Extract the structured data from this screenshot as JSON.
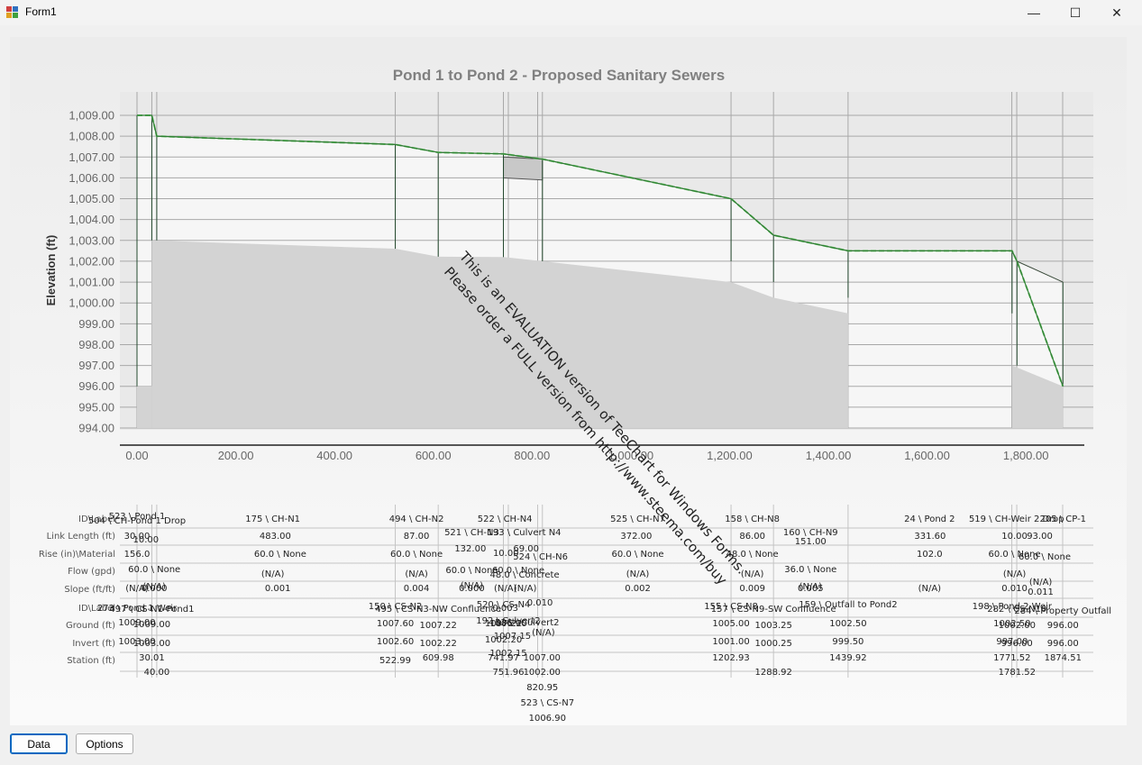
{
  "window": {
    "title": "Form1",
    "minimize_glyph": "—",
    "maximize_glyph": "☐",
    "close_glyph": "✕"
  },
  "buttons": {
    "data": "Data",
    "options": "Options"
  },
  "watermark": {
    "line1": "This is an EVALUATION version of TeeChart for Windows Forms.",
    "line2": "Please order a FULL version from http://www.steema.com/buy"
  },
  "chart_data": {
    "type": "line",
    "title": "Pond 1 to Pond 2 - Proposed Sanitary Sewers",
    "ylabel": "Elevation (ft)",
    "xlabel": "",
    "ylim": [
      994,
      1009
    ],
    "xlim": [
      0,
      1880
    ],
    "grid": true,
    "y_ticks": [
      "1,009.00",
      "1,008.00",
      "1,007.00",
      "1,006.00",
      "1,005.00",
      "1,004.00",
      "1,003.00",
      "1,002.00",
      "1,001.00",
      "1,000.00",
      "999.00",
      "998.00",
      "997.00",
      "996.00",
      "995.00",
      "994.00"
    ],
    "x_ticks": [
      "0.00",
      "200.00",
      "400.00",
      "600.00",
      "800.00",
      "1,000.00",
      "1,200.00",
      "1,400.00",
      "1,600.00",
      "1,800.00"
    ],
    "node_stations": [
      0,
      30.01,
      40,
      522.99,
      609.98,
      741.97,
      751.96,
      811.32,
      820.95,
      1202.93,
      1288.92,
      1439.92,
      1771.52,
      1781.52,
      1874.51
    ],
    "hgl_series": {
      "x": [
        0,
        30,
        40,
        523,
        610,
        742,
        821,
        1203,
        1289,
        1440,
        1772,
        1782,
        1875
      ],
      "y": [
        1009.0,
        1009.0,
        1008.0,
        1007.6,
        1007.22,
        1007.15,
        1006.9,
        1005.0,
        1003.25,
        1002.5,
        1002.5,
        1002.0,
        996.0
      ]
    },
    "crown_series": {
      "x": [
        0,
        30,
        40,
        523,
        610,
        742,
        821,
        1203,
        1289,
        1440,
        1772,
        1782,
        1875
      ],
      "y": [
        1009.0,
        1009.0,
        1008.0,
        1007.6,
        1007.22,
        1007.15,
        1006.9,
        1005.0,
        1003.25,
        1002.5,
        1002.5,
        1002.0,
        1001.0
      ]
    },
    "ground_series": {
      "x": [
        30,
        523,
        610,
        742,
        821,
        1203,
        1289,
        1440
      ],
      "y": [
        1003.0,
        1002.6,
        1002.22,
        1002.2,
        1002.0,
        1001.0,
        1000.25,
        999.5
      ]
    },
    "ground_series_b": {
      "x": [
        1772,
        1875
      ],
      "y": [
        997.0,
        996.0
      ]
    },
    "pond1_ground": {
      "x": [
        0,
        30
      ],
      "y": 996.0
    },
    "culvert_box": {
      "x": [
        742,
        821
      ],
      "y_top": 1007.0,
      "y_bottom": 1006.0
    },
    "structure_bottoms": [
      996.0,
      1003.0,
      1003.0,
      1002.6,
      1002.22,
      1002.2,
      1002.0,
      1002.0,
      1001.0,
      1000.25,
      999.5,
      997.0,
      996.0,
      996.0
    ],
    "table_row_labels": [
      "ID\\Label",
      "Link Length (ft)",
      "Rise (in)\\Material",
      "Flow (gpd)",
      "Slope (ft/ft)",
      "ID\\Label",
      "Ground (ft)",
      "Invert (ft)",
      "Station (ft)"
    ],
    "table_cells": [
      {
        "text": "523 \\ Pond 1",
        "s": 0,
        "r": 0,
        "dy": -3
      },
      {
        "text": "504 \\ CH-Pond 1 Drop",
        "s": 0,
        "r": 0,
        "dy": 2
      },
      {
        "text": "175 \\ CH-N1",
        "s": 275,
        "r": 0,
        "dy": 0
      },
      {
        "text": "494 \\ CH-N2",
        "s": 566,
        "r": 0,
        "dy": 0
      },
      {
        "text": "522 \\ CH-N4",
        "s": 745,
        "r": 0,
        "dy": 0
      },
      {
        "text": "525 \\ CH-N7",
        "s": 1014,
        "r": 0,
        "dy": 0
      },
      {
        "text": "158 \\ CH-N8",
        "s": 1246,
        "r": 0,
        "dy": 0
      },
      {
        "text": "24 \\ Pond 2",
        "s": 1605,
        "r": 0,
        "dy": 0
      },
      {
        "text": "519 \\ CH-Weir 2 Drop",
        "s": 1781,
        "r": 0,
        "dy": 0
      },
      {
        "text": "205 \\ CP-1",
        "s": 1875,
        "r": 0,
        "dy": 0
      },
      {
        "text": "521 \\ CH-N3",
        "s": 678,
        "r": 1,
        "dy": -4
      },
      {
        "text": "193 \\ Culvert N4",
        "s": 784,
        "r": 1,
        "dy": -4
      },
      {
        "text": "160 \\ CH-N9",
        "s": 1364,
        "r": 1,
        "dy": -4
      },
      {
        "text": "524 \\ CH-N6",
        "s": 817,
        "r": 1,
        "dy": 23
      },
      {
        "text": "30.00",
        "s": 0,
        "r": 1,
        "dy": 0
      },
      {
        "text": "10.00",
        "s": 18,
        "r": 1,
        "dy": 4
      },
      {
        "text": "483.00",
        "s": 280,
        "r": 1,
        "dy": 0
      },
      {
        "text": "87.00",
        "s": 566,
        "r": 1,
        "dy": 0
      },
      {
        "text": "132.00",
        "s": 675,
        "r": 1,
        "dy": 14
      },
      {
        "text": "10.00",
        "s": 747,
        "r": 1,
        "dy": 19
      },
      {
        "text": "69.00",
        "s": 788,
        "r": 1,
        "dy": 14
      },
      {
        "text": "372.00",
        "s": 1011,
        "r": 1,
        "dy": 0
      },
      {
        "text": "86.00",
        "s": 1246,
        "r": 1,
        "dy": 0
      },
      {
        "text": "151.00",
        "s": 1364,
        "r": 1,
        "dy": 6
      },
      {
        "text": "331.60",
        "s": 1606,
        "r": 1,
        "dy": 0
      },
      {
        "text": "10.00",
        "s": 1777,
        "r": 1,
        "dy": 0
      },
      {
        "text": "93.00",
        "s": 1828,
        "r": 1,
        "dy": 0
      },
      {
        "text": "156.0",
        "s": 0,
        "r": 2,
        "dy": 0
      },
      {
        "text": "60.0 \\ None",
        "s": 290,
        "r": 2,
        "dy": 0
      },
      {
        "text": "60.0 \\ None",
        "s": 566,
        "r": 2,
        "dy": 0
      },
      {
        "text": "60.0 \\ None",
        "s": 1014,
        "r": 2,
        "dy": 0
      },
      {
        "text": "48.0 \\ None",
        "s": 1246,
        "r": 2,
        "dy": 0
      },
      {
        "text": "102.0",
        "s": 1605,
        "r": 2,
        "dy": 0
      },
      {
        "text": "60.0 \\ None",
        "s": 1777,
        "r": 2,
        "dy": 0
      },
      {
        "text": "60.0 \\ None",
        "s": 1838,
        "r": 2,
        "dy": 3
      },
      {
        "text": "60.0 \\ None",
        "s": 35,
        "r": 2,
        "dy": 17
      },
      {
        "text": "60.0 \\ None",
        "s": 678,
        "r": 2,
        "dy": 18
      },
      {
        "text": "60.0 \\ None",
        "s": 772,
        "r": 2,
        "dy": 18
      },
      {
        "text": "48.0 \\ Concrete",
        "s": 785,
        "r": 2,
        "dy": 23
      },
      {
        "text": "36.0 \\ None",
        "s": 1364,
        "r": 2,
        "dy": 17
      },
      {
        "text": "(N/A)",
        "s": 275,
        "r": 3,
        "dy": 3
      },
      {
        "text": "(N/A)",
        "s": 566,
        "r": 3,
        "dy": 3
      },
      {
        "text": "(N/A)",
        "s": 1014,
        "r": 3,
        "dy": 3
      },
      {
        "text": "(N/A)",
        "s": 1246,
        "r": 3,
        "dy": 3
      },
      {
        "text": "(N/A)",
        "s": 1777,
        "r": 3,
        "dy": 3
      },
      {
        "text": "(N/A)",
        "s": 1830,
        "r": 3,
        "dy": 12
      },
      {
        "text": "(N/A)",
        "s": 35,
        "r": 3,
        "dy": 17
      },
      {
        "text": "(N/A)",
        "s": 678,
        "r": 3,
        "dy": 16
      },
      {
        "text": "(N/A)",
        "s": 1364,
        "r": 3,
        "dy": 17
      },
      {
        "text": "(N/A)",
        "s": 0,
        "r": 4,
        "dy": -1
      },
      {
        "text": "0.000",
        "s": 35,
        "r": 4,
        "dy": -1
      },
      {
        "text": "0.001",
        "s": 285,
        "r": 4,
        "dy": -1
      },
      {
        "text": "0.004",
        "s": 566,
        "r": 4,
        "dy": -1
      },
      {
        "text": "0.000",
        "s": 678,
        "r": 4,
        "dy": -1
      },
      {
        "text": "(N/A)",
        "s": 746,
        "r": 4,
        "dy": -1
      },
      {
        "text": "(N/A)",
        "s": 786,
        "r": 4,
        "dy": -1
      },
      {
        "text": "0.010",
        "s": 816,
        "r": 4,
        "dy": 15
      },
      {
        "text": "0.002",
        "s": 1014,
        "r": 4,
        "dy": -1
      },
      {
        "text": "0.009",
        "s": 1246,
        "r": 4,
        "dy": -1
      },
      {
        "text": "0.005",
        "s": 1364,
        "r": 4,
        "dy": -1
      },
      {
        "text": "(N/A)",
        "s": 1605,
        "r": 4,
        "dy": -1
      },
      {
        "text": "0.010",
        "s": 1777,
        "r": 4,
        "dy": -1
      },
      {
        "text": "0.011",
        "s": 1830,
        "r": 4,
        "dy": 3
      },
      {
        "text": "0.003",
        "s": 746,
        "r": 4,
        "dy": 21
      },
      {
        "text": "273 \\ Pond 1 Weir",
        "s": 0,
        "r": 5,
        "dy": 0
      },
      {
        "text": "497 \\ CS-N1-Pond1",
        "s": 30,
        "r": 5,
        "dy": 1
      },
      {
        "text": "150 \\ CS-N2",
        "s": 523,
        "r": 5,
        "dy": -2
      },
      {
        "text": "495 \\ CS-N3-NW Confluence",
        "s": 610,
        "r": 5,
        "dy": 1
      },
      {
        "text": "520 \\ CS-N4",
        "s": 742,
        "r": 5,
        "dy": -4
      },
      {
        "text": "192 \\ Culvert2",
        "s": 752,
        "r": 5,
        "dy": 14
      },
      {
        "text": "526 \\ Culvert2",
        "s": 790,
        "r": 5,
        "dy": 16
      },
      {
        "text": "155 \\ CS-N8",
        "s": 1203,
        "r": 5,
        "dy": -2
      },
      {
        "text": "157 \\ CS-N9-SW Confluence",
        "s": 1289,
        "r": 5,
        "dy": 1
      },
      {
        "text": "159 \\ Outfall to Pond2",
        "s": 1440,
        "r": 5,
        "dy": -4
      },
      {
        "text": "198 \\ Pond 2 Weir",
        "s": 1772,
        "r": 5,
        "dy": -2
      },
      {
        "text": "282 \\ CS-N10",
        "s": 1782,
        "r": 5,
        "dy": 1
      },
      {
        "text": "284 \\ Property Outfall",
        "s": 1875,
        "r": 5,
        "dy": 3
      },
      {
        "text": "1009.00",
        "s": 0,
        "r": 6,
        "dy": -3
      },
      {
        "text": "1009.00",
        "s": 30,
        "r": 6,
        "dy": -1
      },
      {
        "text": "1007.60",
        "s": 523,
        "r": 6,
        "dy": -2
      },
      {
        "text": "1007.22",
        "s": 610,
        "r": 6,
        "dy": 0
      },
      {
        "text": "1007.22",
        "s": 742,
        "r": 6,
        "dy": -2
      },
      {
        "text": "1006.90",
        "s": 752,
        "r": 6,
        "dy": -2
      },
      {
        "text": "1005.00",
        "s": 1203,
        "r": 6,
        "dy": -2
      },
      {
        "text": "1003.25",
        "s": 1289,
        "r": 6,
        "dy": 0
      },
      {
        "text": "1002.50",
        "s": 1440,
        "r": 6,
        "dy": -2
      },
      {
        "text": "1002.50",
        "s": 1772,
        "r": 6,
        "dy": -2
      },
      {
        "text": "1002.00",
        "s": 1782,
        "r": 6,
        "dy": 0
      },
      {
        "text": "996.00",
        "s": 1875,
        "r": 6,
        "dy": 0
      },
      {
        "text": "1003.00",
        "s": 0,
        "r": 7,
        "dy": -2
      },
      {
        "text": "1003.00",
        "s": 30,
        "r": 7,
        "dy": 0
      },
      {
        "text": "1002.60",
        "s": 523,
        "r": 7,
        "dy": -2
      },
      {
        "text": "1002.22",
        "s": 610,
        "r": 7,
        "dy": 0
      },
      {
        "text": "1002.20",
        "s": 742,
        "r": 7,
        "dy": -4
      },
      {
        "text": "1002.15",
        "s": 752,
        "r": 7,
        "dy": 11
      },
      {
        "text": "1007.15",
        "s": 760,
        "r": 7,
        "dy": -8
      },
      {
        "text": "(N/A)",
        "s": 823,
        "r": 7,
        "dy": -12
      },
      {
        "text": "1001.00",
        "s": 1203,
        "r": 7,
        "dy": -2
      },
      {
        "text": "1000.25",
        "s": 1289,
        "r": 7,
        "dy": 0
      },
      {
        "text": "999.50",
        "s": 1440,
        "r": 7,
        "dy": -2
      },
      {
        "text": "997.00",
        "s": 1772,
        "r": 7,
        "dy": -2
      },
      {
        "text": "996.00",
        "s": 1782,
        "r": 7,
        "dy": 0
      },
      {
        "text": "996.00",
        "s": 1875,
        "r": 7,
        "dy": 0
      },
      {
        "text": "30.01",
        "s": 30,
        "r": 8,
        "dy": -3
      },
      {
        "text": "40.00",
        "s": 40,
        "r": 8,
        "dy": 13
      },
      {
        "text": "522.99",
        "s": 523,
        "r": 8,
        "dy": 0
      },
      {
        "text": "609.98",
        "s": 610,
        "r": 8,
        "dy": -3
      },
      {
        "text": "741.97",
        "s": 742,
        "r": 8,
        "dy": -3
      },
      {
        "text": "1007.00",
        "s": 820,
        "r": 8,
        "dy": -3
      },
      {
        "text": "751.96",
        "s": 752,
        "r": 8,
        "dy": 13
      },
      {
        "text": "1002.00",
        "s": 820,
        "r": 8,
        "dy": 13
      },
      {
        "text": "820.95",
        "s": 821,
        "r": 8,
        "dy": 30
      },
      {
        "text": "523 \\ CS-N7",
        "s": 831,
        "r": 8,
        "dy": 47
      },
      {
        "text": "1006.90",
        "s": 831,
        "r": 8,
        "dy": 64
      },
      {
        "text": "1202.93",
        "s": 1203,
        "r": 8,
        "dy": -3
      },
      {
        "text": "1288.92",
        "s": 1289,
        "r": 8,
        "dy": 13
      },
      {
        "text": "1439.92",
        "s": 1440,
        "r": 8,
        "dy": -3
      },
      {
        "text": "1771.52",
        "s": 1772,
        "r": 8,
        "dy": -3
      },
      {
        "text": "1781.52",
        "s": 1782,
        "r": 8,
        "dy": 13
      },
      {
        "text": "1874.51",
        "s": 1875,
        "r": 8,
        "dy": -3
      }
    ]
  }
}
